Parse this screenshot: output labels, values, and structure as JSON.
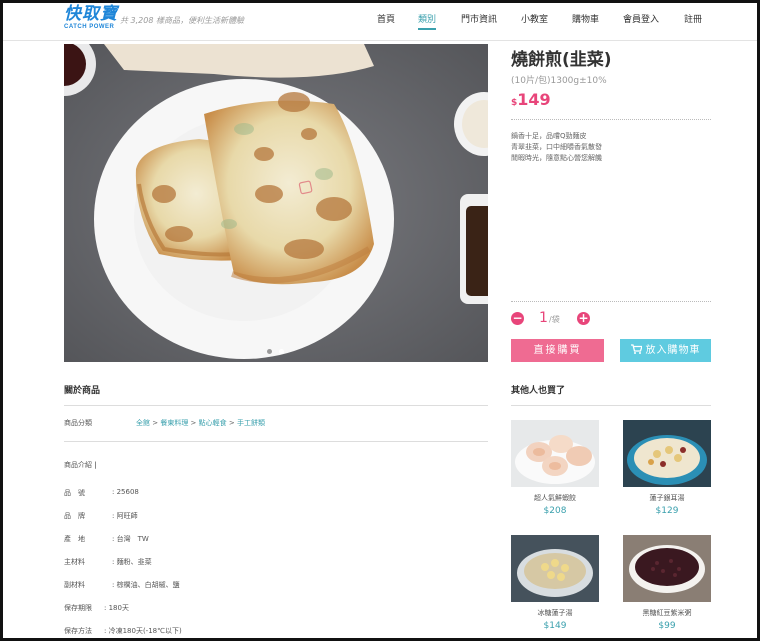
{
  "header": {
    "logo_cn": "快取寶",
    "logo_en": "CATCH POWER",
    "tagline": "共 3,208 樣商品，便利生活新體驗",
    "nav": [
      "首頁",
      "類別",
      "門市資訊",
      "小教室",
      "購物車",
      "會員登入",
      "註冊"
    ],
    "active_nav": "類別",
    "accent_color": "#3aa0ad"
  },
  "product": {
    "name": "燒餅煎(韭菜)",
    "spec": "(10片/包)1300g±10%",
    "currency": "$",
    "price": "149",
    "description": [
      "鍋香十足，品嚐Q勁麵皮",
      "青翠韭菜，口中細嚼香氣散發",
      "閒暇時光，隨意點心營您解饑"
    ],
    "quantity": "1",
    "unit": "/袋",
    "minus_icon": "minus-icon",
    "plus_icon": "plus-icon",
    "buy_label": "直接購買",
    "cart_label": "放入購物車",
    "price_color": "#e8457a"
  },
  "about": {
    "title": "關於商品",
    "category_label": "商品分類",
    "breadcrumbs": [
      "全館",
      "餐東料理",
      "點心輕食",
      "手工餅類"
    ],
    "intro_label": "商品介紹",
    "specs": [
      {
        "label": "品　號",
        "value": "25608"
      },
      {
        "label": "品　牌",
        "value": "阿旺師"
      },
      {
        "label": "產　地",
        "value": "台灣　TW"
      },
      {
        "label": "主材料",
        "value": "麵粉、韭菜"
      },
      {
        "label": "副材料",
        "value": "棕櫚油、白胡椒、鹽"
      },
      {
        "label": "保存期限",
        "value": "180天"
      },
      {
        "label": "保存方法",
        "value": "冷凍180天(-18℃以下)"
      }
    ]
  },
  "also_bought": {
    "title": "其他人也買了",
    "items": [
      {
        "name": "超人氣鮮蝦餃",
        "price": "$208"
      },
      {
        "name": "蓮子銀耳湯",
        "price": "$129"
      },
      {
        "name": "冰糖蓮子湯",
        "price": "$149"
      },
      {
        "name": "黑糖紅豆紫米粥",
        "price": "$99"
      }
    ]
  }
}
